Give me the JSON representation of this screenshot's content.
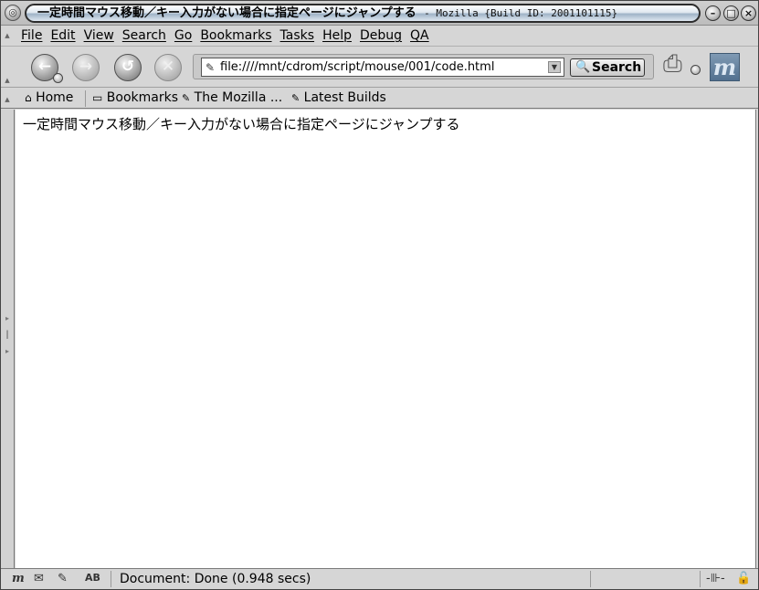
{
  "window": {
    "title": "一定時間マウス移動／キー入力がない場合に指定ページにジャンプする",
    "app_suffix": "- Mozilla {Build ID: 2001101115}"
  },
  "menubar": {
    "items": [
      "File",
      "Edit",
      "View",
      "Search",
      "Go",
      "Bookmarks",
      "Tasks",
      "Help",
      "Debug",
      "QA"
    ]
  },
  "navbar": {
    "url": "file:////mnt/cdrom/script/mouse/001/code.html",
    "search_label": "Search",
    "back_icon": "back-arrow-icon",
    "forward_icon": "forward-arrow-icon",
    "reload_icon": "reload-icon",
    "stop_icon": "stop-icon"
  },
  "personal_toolbar": {
    "items": [
      "Home",
      "Bookmarks",
      "The Mozilla ...",
      "Latest Builds"
    ]
  },
  "content": {
    "text": "一定時間マウス移動／キー入力がない場合に指定ページにジャンプする"
  },
  "statusbar": {
    "text": "Document: Done (0.948 secs)"
  },
  "colors": {
    "background": "#d6d6d6",
    "content_background": "#ffffff",
    "logo_blue": "#5c7b9b"
  }
}
